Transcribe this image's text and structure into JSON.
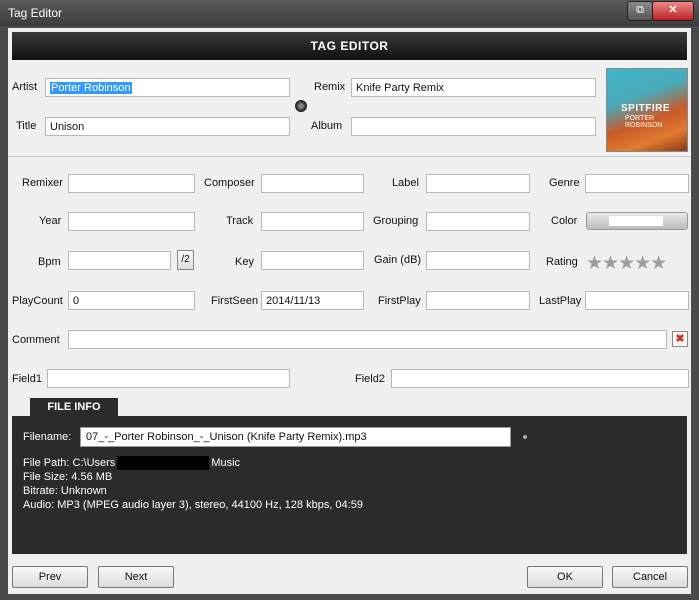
{
  "window": {
    "title": "Tag Editor",
    "restore_glyph": "⧉",
    "close_glyph": "✕"
  },
  "header": {
    "title": "TAG EDITOR"
  },
  "fields": {
    "artist": {
      "label": "Artist",
      "value": "Porter Robinson"
    },
    "remix": {
      "label": "Remix",
      "value": "Knife Party Remix"
    },
    "title": {
      "label": "Title",
      "value": "Unison"
    },
    "album": {
      "label": "Album",
      "value": ""
    },
    "remixer": {
      "label": "Remixer",
      "value": ""
    },
    "composer": {
      "label": "Composer",
      "value": ""
    },
    "label": {
      "label": "Label",
      "value": ""
    },
    "genre": {
      "label": "Genre",
      "value": ""
    },
    "year": {
      "label": "Year",
      "value": ""
    },
    "track": {
      "label": "Track",
      "value": ""
    },
    "grouping": {
      "label": "Grouping",
      "value": ""
    },
    "color": {
      "label": "Color"
    },
    "bpm": {
      "label": "Bpm",
      "value": "",
      "half_button": "/2"
    },
    "key": {
      "label": "Key",
      "value": ""
    },
    "gain": {
      "label": "Gain (dB)",
      "value": ""
    },
    "rating": {
      "label": "Rating",
      "value": 0,
      "max": 5,
      "stars": "★★★★★"
    },
    "playcount": {
      "label": "PlayCount",
      "value": "0"
    },
    "firstseen": {
      "label": "FirstSeen",
      "value": "2014/11/13"
    },
    "firstplay": {
      "label": "FirstPlay",
      "value": ""
    },
    "lastplay": {
      "label": "LastPlay",
      "value": ""
    },
    "comment": {
      "label": "Comment",
      "value": "",
      "clear_glyph": "✖"
    },
    "field1": {
      "label": "Field1",
      "value": ""
    },
    "field2": {
      "label": "Field2",
      "value": ""
    }
  },
  "cover": {
    "text": "SPITFIRE",
    "subtext": "PORTER ROBINSON"
  },
  "file_info": {
    "tab": "FILE INFO",
    "filename_label": "Filename:",
    "filename": "07_-_Porter Robinson_-_Unison (Knife Party Remix).mp3",
    "file_path_prefix": "File Path: C:\\Users",
    "file_path_suffix": "Music",
    "file_size": "File Size: 4.56 MB",
    "bitrate": "Bitrate: Unknown",
    "audio": "Audio: MP3 (MPEG audio layer 3), stereo, 44100 Hz, 128 kbps, 04:59"
  },
  "buttons": {
    "prev": "Prev",
    "next": "Next",
    "ok": "OK",
    "cancel": "Cancel"
  },
  "colors": {
    "header_bg": "#1f1f1f",
    "panel_bg": "#2b2b2b",
    "selection": "#3399ff"
  }
}
